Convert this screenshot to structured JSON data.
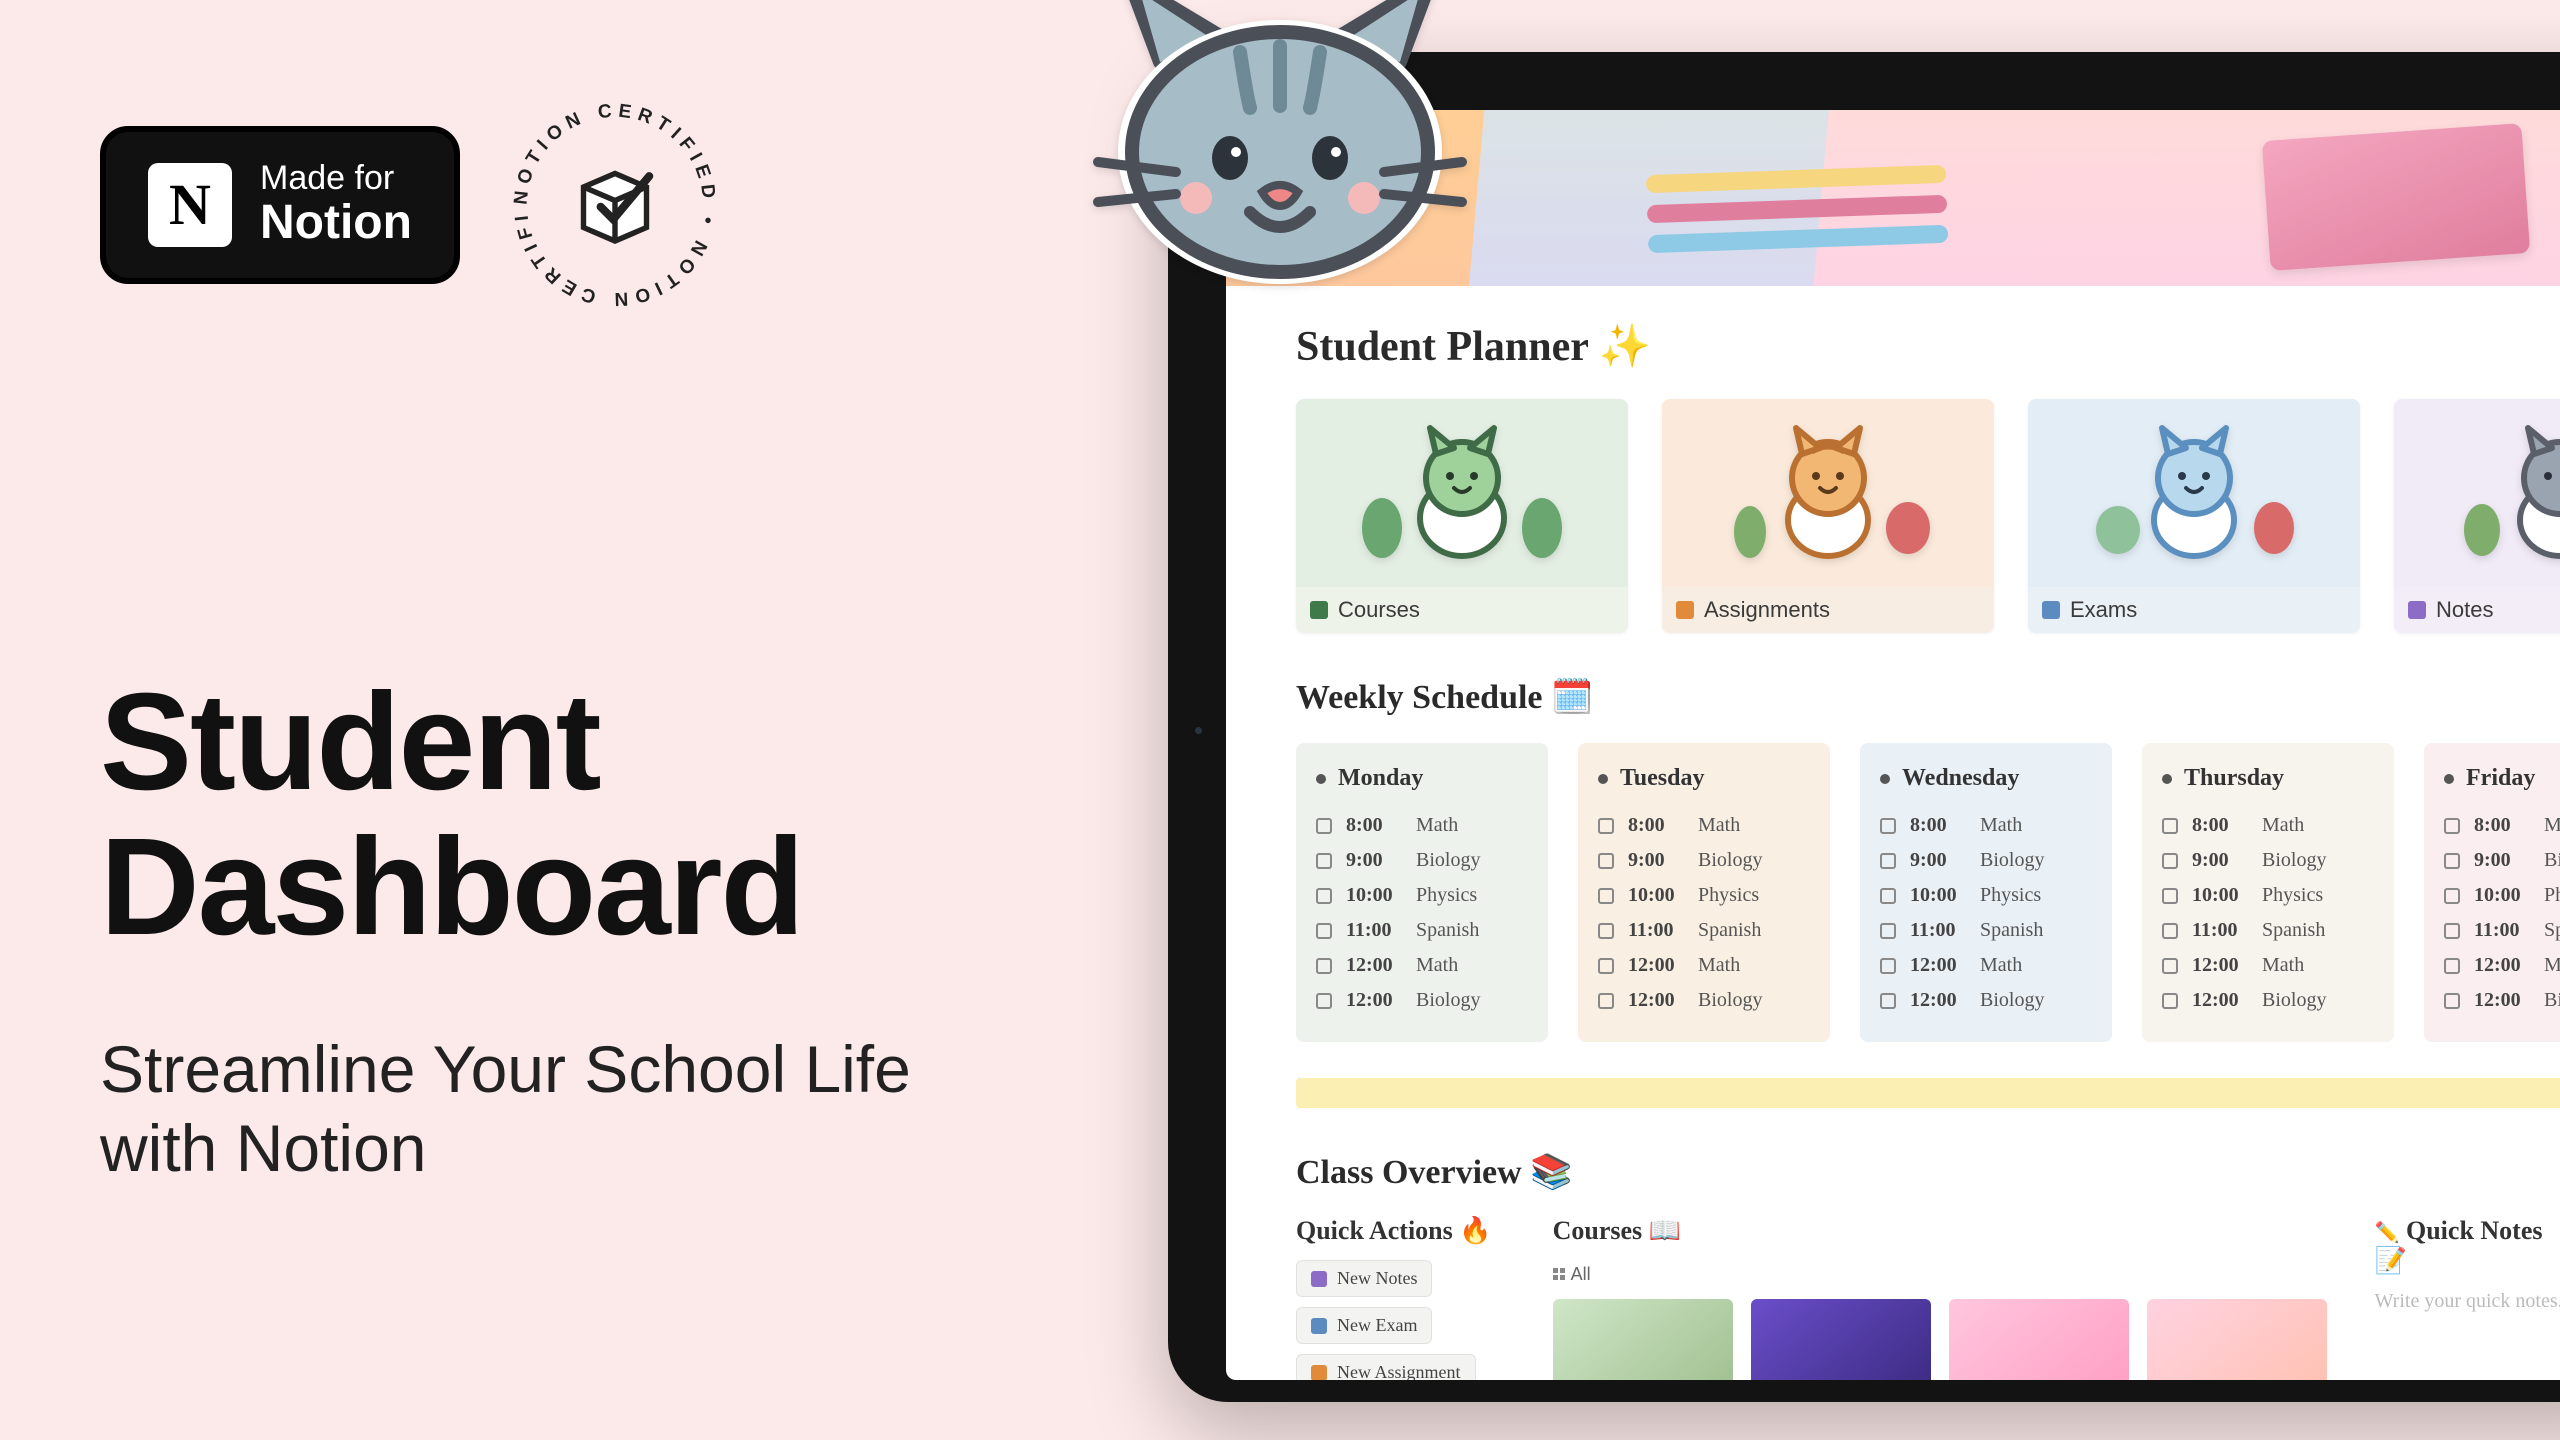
{
  "marketing": {
    "badge_line1": "Made for",
    "badge_line2": "Notion",
    "cert_text": "NOTION CERTIFIED • NOTION CERTIFIED •",
    "title": "Student Dashboard",
    "subtitle": "Streamline Your School Life with Notion"
  },
  "planner": {
    "title": "Student Planner ✨",
    "cards": [
      {
        "label": "Courses",
        "icon_color": "#3e7a4a"
      },
      {
        "label": "Assignments",
        "icon_color": "#e08a3a"
      },
      {
        "label": "Exams",
        "icon_color": "#5b8bc0"
      },
      {
        "label": "Notes",
        "icon_color": "#8c6cc7"
      }
    ]
  },
  "schedule": {
    "title": "Weekly Schedule 🗓️",
    "days": [
      {
        "name": "Monday"
      },
      {
        "name": "Tuesday"
      },
      {
        "name": "Wednesday"
      },
      {
        "name": "Thursday"
      },
      {
        "name": "Friday"
      }
    ],
    "classes": [
      {
        "time": "8:00",
        "subject": "Math"
      },
      {
        "time": "9:00",
        "subject": "Biology"
      },
      {
        "time": "10:00",
        "subject": "Physics"
      },
      {
        "time": "11:00",
        "subject": "Spanish"
      },
      {
        "time": "12:00",
        "subject": "Math"
      },
      {
        "time": "12:00",
        "subject": "Biology"
      }
    ]
  },
  "overview": {
    "title": "Class Overview 📚",
    "quick_actions": {
      "title": "Quick Actions 🔥",
      "buttons": [
        {
          "label": "New Notes",
          "icon_color": "#8c6cc7"
        },
        {
          "label": "New Exam",
          "icon_color": "#5b8bc0"
        },
        {
          "label": "New Assignment",
          "icon_color": "#e08a3a"
        }
      ]
    },
    "courses": {
      "title": "Courses 📖",
      "chip": "All"
    },
    "quick_notes": {
      "title": "Quick Notes 📝",
      "placeholder": "Write your quick notes..."
    }
  }
}
